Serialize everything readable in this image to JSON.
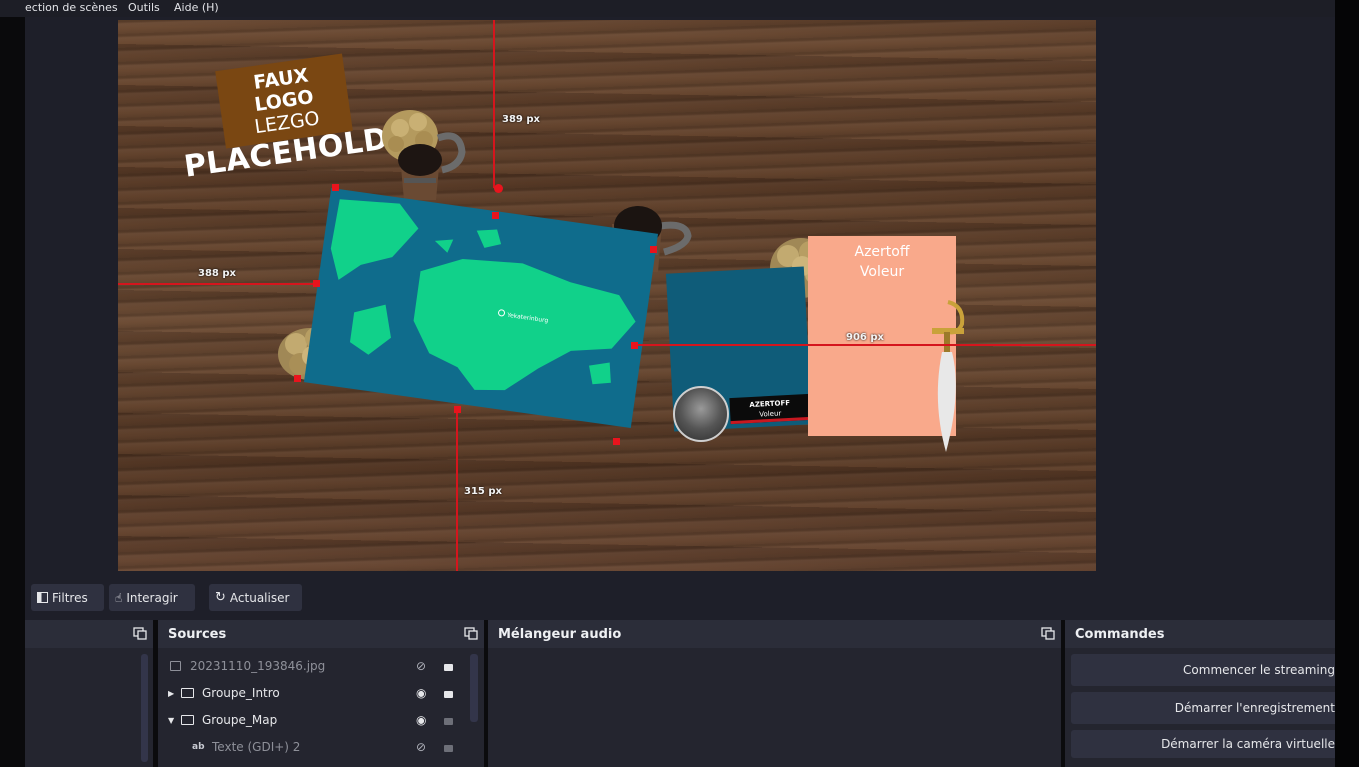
{
  "menu": {
    "items": [
      "ection de scènes",
      "Outils",
      "Aide (H)"
    ]
  },
  "preview": {
    "logo_lines": [
      "FAUX",
      "LOGO",
      "LEZGO"
    ],
    "placeholder_text": "PLACEHOLDE",
    "map_label": "Yekaterinburg",
    "card_title": "Azertoff",
    "card_subtitle": "Voleur",
    "banner_title": "AZERTOFF",
    "banner_subtitle": "Voleur",
    "guides": {
      "top": "389 px",
      "left": "388 px",
      "right": "906 px",
      "bottom": "315 px"
    }
  },
  "toolbar": {
    "filters_label": "Filtres",
    "interact_label": "Interagir",
    "refresh_label": "Actualiser"
  },
  "sources": {
    "title": "Sources",
    "items": [
      {
        "name": "20231110_193846.jpg",
        "icon": "image-icon",
        "visible": false,
        "locked": true
      },
      {
        "name": "Groupe_Intro",
        "icon": "folder-icon",
        "visible": true,
        "locked": true
      },
      {
        "name": "Groupe_Map",
        "icon": "folder-icon",
        "visible": true,
        "locked": false
      },
      {
        "name": "Texte (GDI+) 2",
        "icon": "text-icon",
        "visible": false,
        "locked": false
      }
    ]
  },
  "mixer": {
    "title": "Mélangeur audio"
  },
  "commands": {
    "title": "Commandes",
    "start_streaming": "Commencer le streaming",
    "start_recording": "Démarrer l'enregistrement",
    "start_virtual_camera": "Démarrer la caméra virtuelle"
  },
  "colors": {
    "panel_bg": "#24252f",
    "dock_header": "#2b2d39",
    "button_bg": "#2f3140",
    "guide_red": "#d5151d",
    "map_ocean": "#0f6c8c",
    "map_land": "#11d18a",
    "card_peach": "#f9a98b",
    "logo_brown": "#7a4712"
  }
}
